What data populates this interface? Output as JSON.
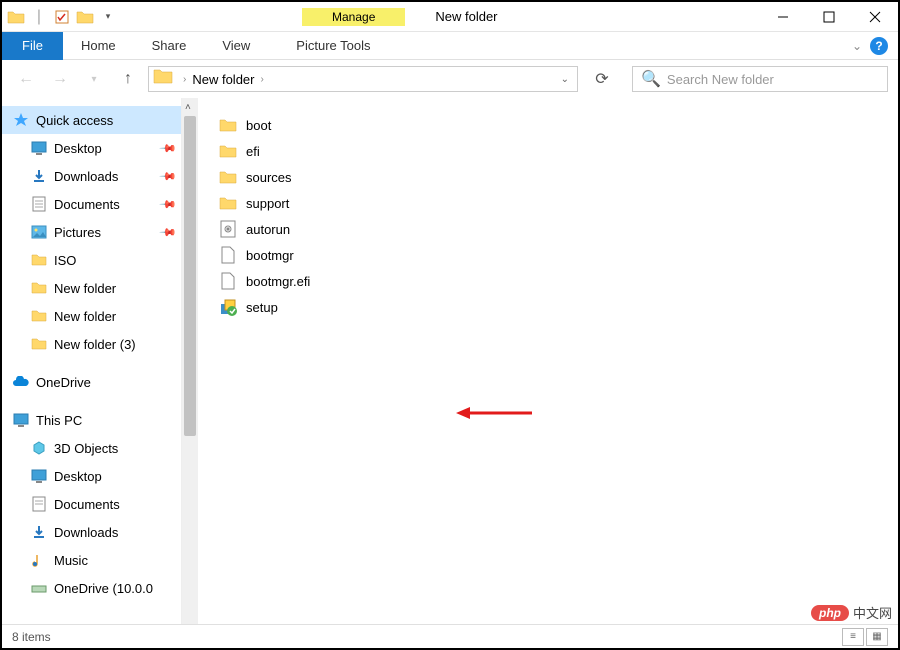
{
  "titlebar": {
    "context_label": "Manage",
    "window_title": "New folder"
  },
  "ribbon": {
    "file": "File",
    "tabs": [
      "Home",
      "Share",
      "View"
    ],
    "context_tab": "Picture Tools"
  },
  "nav": {
    "breadcrumb": [
      "New folder"
    ],
    "search_placeholder": "Search New folder"
  },
  "sidebar": {
    "quick_access": "Quick access",
    "qa_items": [
      {
        "label": "Desktop",
        "icon": "desktop",
        "pinned": true
      },
      {
        "label": "Downloads",
        "icon": "downloads",
        "pinned": true
      },
      {
        "label": "Documents",
        "icon": "documents",
        "pinned": true
      },
      {
        "label": "Pictures",
        "icon": "pictures",
        "pinned": true
      },
      {
        "label": "ISO",
        "icon": "folder",
        "pinned": false
      },
      {
        "label": "New folder",
        "icon": "folder",
        "pinned": false
      },
      {
        "label": "New folder",
        "icon": "folder",
        "pinned": false
      },
      {
        "label": "New folder (3)",
        "icon": "folder",
        "pinned": false
      }
    ],
    "onedrive": "OneDrive",
    "this_pc": "This PC",
    "pc_items": [
      {
        "label": "3D Objects",
        "icon": "3d"
      },
      {
        "label": "Desktop",
        "icon": "desktop"
      },
      {
        "label": "Documents",
        "icon": "documents"
      },
      {
        "label": "Downloads",
        "icon": "downloads"
      },
      {
        "label": "Music",
        "icon": "music"
      },
      {
        "label": "OneDrive (10.0.0",
        "icon": "drive"
      }
    ]
  },
  "files": [
    {
      "name": "boot",
      "type": "folder"
    },
    {
      "name": "efi",
      "type": "folder"
    },
    {
      "name": "sources",
      "type": "folder"
    },
    {
      "name": "support",
      "type": "folder"
    },
    {
      "name": "autorun",
      "type": "inf"
    },
    {
      "name": "bootmgr",
      "type": "file"
    },
    {
      "name": "bootmgr.efi",
      "type": "file"
    },
    {
      "name": "setup",
      "type": "exe"
    }
  ],
  "status": {
    "item_count": "8 items"
  },
  "watermark": {
    "brand": "php",
    "text": "中文网"
  }
}
